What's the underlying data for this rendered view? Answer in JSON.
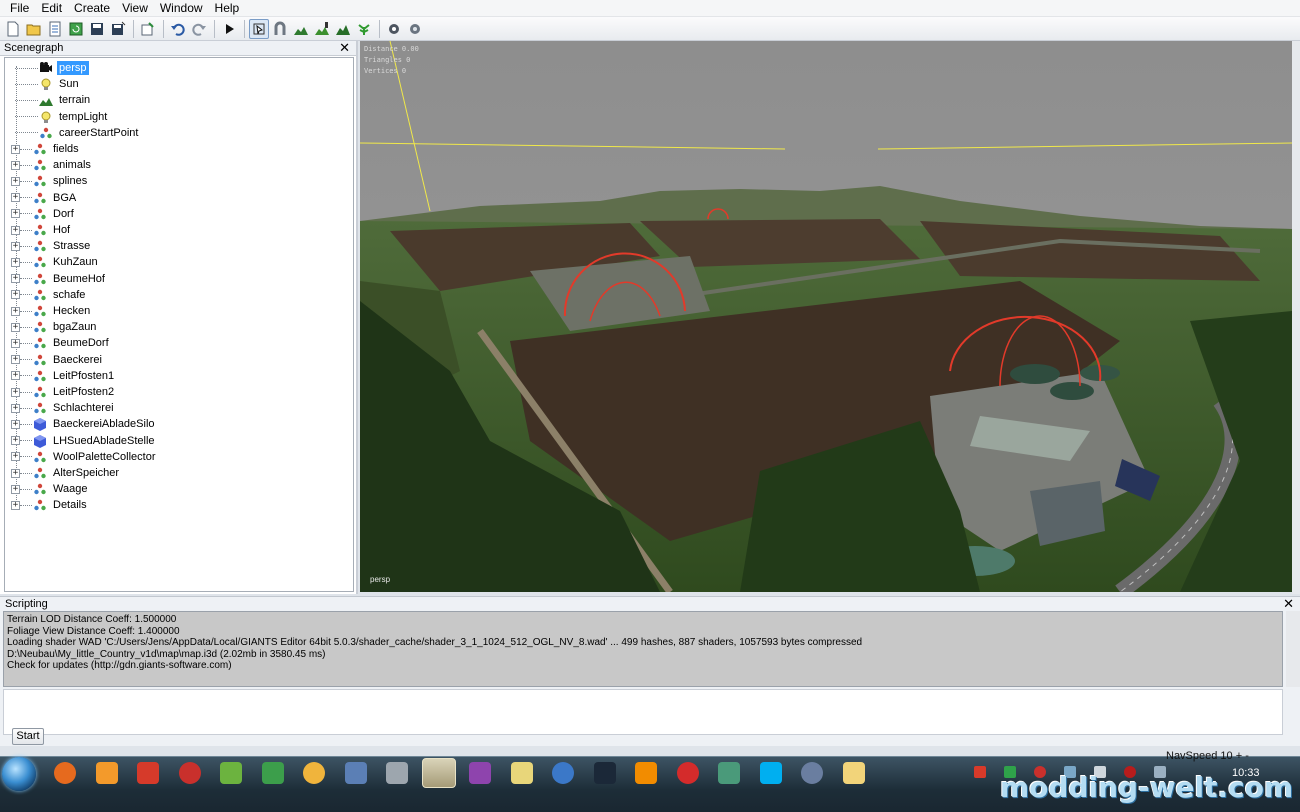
{
  "menu": [
    "File",
    "Edit",
    "Create",
    "View",
    "Window",
    "Help"
  ],
  "toolbar": {
    "icons": [
      "new-icon",
      "open-icon",
      "open-list-icon",
      "refresh-icon",
      "save-icon",
      "save-all-icon",
      "import-icon",
      "undo-icon",
      "redo-icon",
      "play-icon",
      "select-icon",
      "magnet-icon",
      "terrain-sculpt-icon",
      "terrain-paint-icon",
      "terrain-detail-icon",
      "foliage-icon",
      "cog-icon",
      "cog-alt-icon"
    ]
  },
  "scenegraph": {
    "title": "Scenegraph",
    "close": "✕",
    "nodes": [
      {
        "label": "persp",
        "icon": "camera-icon",
        "expandable": false,
        "selected": true
      },
      {
        "label": "Sun",
        "icon": "light-icon",
        "expandable": false
      },
      {
        "label": "terrain",
        "icon": "terrain-icon",
        "expandable": false
      },
      {
        "label": "tempLight",
        "icon": "light-icon",
        "expandable": false
      },
      {
        "label": "careerStartPoint",
        "icon": "transform-group-icon",
        "expandable": false
      },
      {
        "label": "fields",
        "icon": "transform-group-icon",
        "expandable": true
      },
      {
        "label": "animals",
        "icon": "transform-group-icon",
        "expandable": true
      },
      {
        "label": "splines",
        "icon": "transform-group-icon",
        "expandable": true
      },
      {
        "label": "BGA",
        "icon": "transform-group-icon",
        "expandable": true
      },
      {
        "label": "Dorf",
        "icon": "transform-group-icon",
        "expandable": true
      },
      {
        "label": "Hof",
        "icon": "transform-group-icon",
        "expandable": true
      },
      {
        "label": "Strasse",
        "icon": "transform-group-icon",
        "expandable": true
      },
      {
        "label": "KuhZaun",
        "icon": "transform-group-icon",
        "expandable": true
      },
      {
        "label": "BeumeHof",
        "icon": "transform-group-icon",
        "expandable": true
      },
      {
        "label": "schafe",
        "icon": "transform-group-icon",
        "expandable": true
      },
      {
        "label": "Hecken",
        "icon": "transform-group-icon",
        "expandable": true
      },
      {
        "label": "bgaZaun",
        "icon": "transform-group-icon",
        "expandable": true
      },
      {
        "label": "BeumeDorf",
        "icon": "transform-group-icon",
        "expandable": true
      },
      {
        "label": "Baeckerei",
        "icon": "transform-group-icon",
        "expandable": true
      },
      {
        "label": "LeitPfosten1",
        "icon": "transform-group-icon",
        "expandable": true
      },
      {
        "label": "LeitPfosten2",
        "icon": "transform-group-icon",
        "expandable": true
      },
      {
        "label": "Schlachterei",
        "icon": "transform-group-icon",
        "expandable": true
      },
      {
        "label": "BaeckereiAbladeSilo",
        "icon": "shape-cube-icon",
        "expandable": true
      },
      {
        "label": "LHSuedAbladeStelle",
        "icon": "shape-cube-icon",
        "expandable": true
      },
      {
        "label": "WoolPaletteCollector",
        "icon": "transform-group-icon",
        "expandable": true
      },
      {
        "label": "AlterSpeicher",
        "icon": "transform-group-icon",
        "expandable": true
      },
      {
        "label": "Waage",
        "icon": "transform-group-icon",
        "expandable": true
      },
      {
        "label": "Details",
        "icon": "transform-group-icon",
        "expandable": true
      }
    ]
  },
  "viewport": {
    "hud": [
      "Distance 0.00",
      "Triangles 0",
      "Vertices 0"
    ],
    "camera_label": "persp"
  },
  "scripting": {
    "title": "Scripting",
    "close": "✕",
    "log": [
      "  Terrain LOD Distance Coeff: 1.500000",
      "  Foliage View Distance Coeff: 1.400000",
      "Loading shader WAD 'C:/Users/Jens/AppData/Local/GIANTS Editor 64bit 5.0.3/shader_cache/shader_3_1_1024_512_OGL_NV_8.wad' ... 499 hashes, 887 shaders, 1057593 bytes compressed",
      "D:\\Neubau\\My_little_Country_v1d\\map\\map.i3d (2.02mb in 3580.45 ms)",
      "Check for updates (http://gdn.giants-software.com)"
    ],
    "start_label": "Start",
    "navspeed": "NavSpeed 10 + -"
  },
  "taskbar": {
    "clock": "10:33",
    "watermark": "modding-welt.com",
    "apps": [
      "firefox-icon",
      "burn-icon",
      "chrome-icon",
      "opera-icon",
      "nvidia-icon",
      "media-player-icon",
      "media-icon",
      "document-icon",
      "webcam-icon",
      "folder-active-icon",
      "archive-icon",
      "notepad-icon",
      "network-icon",
      "steam-icon",
      "vlc-icon",
      "pdf-icon",
      "tool-icon",
      "skype-icon",
      "browser-icon",
      "explorer-icon"
    ]
  },
  "colors": {
    "selection": "#3399ff",
    "viewport_sky": "#8b8b8b",
    "gizmo_red": "#e23a2a",
    "gizmo_yellow": "#f0e84a"
  }
}
